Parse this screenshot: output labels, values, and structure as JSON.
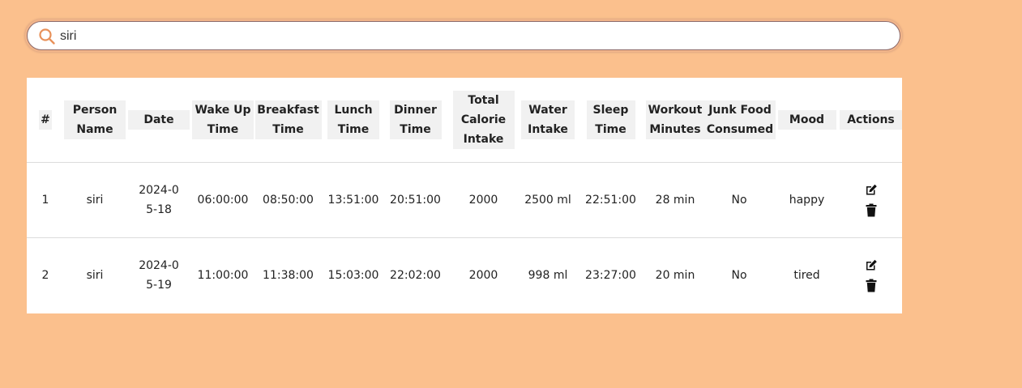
{
  "search": {
    "value": "siri",
    "icon": "search-icon"
  },
  "colors": {
    "page_background": "#fbc08d",
    "search_icon": "#e8915a"
  },
  "table": {
    "headers": [
      "#",
      "Person Name",
      "Date",
      "Wake Up Time",
      "Breakfast Time",
      "Lunch Time",
      "Dinner Time",
      "Total Calorie Intake",
      "Water Intake",
      "Sleep Time",
      "Workout Minutes",
      "Junk Food Consumed",
      "Mood",
      "Actions"
    ],
    "rows": [
      {
        "index": "1",
        "person_name": "siri",
        "date": "2024-05-18",
        "wake_up_time": "06:00:00",
        "breakfast_time": "08:50:00",
        "lunch_time": "13:51:00",
        "dinner_time": "20:51:00",
        "total_calorie_intake": "2000",
        "water_intake": "2500 ml",
        "sleep_time": "22:51:00",
        "workout_minutes": "28 min",
        "junk_food_consumed": "No",
        "mood": "happy"
      },
      {
        "index": "2",
        "person_name": "siri",
        "date": "2024-05-19",
        "wake_up_time": "11:00:00",
        "breakfast_time": "11:38:00",
        "lunch_time": "15:03:00",
        "dinner_time": "22:02:00",
        "total_calorie_intake": "2000",
        "water_intake": "998 ml",
        "sleep_time": "23:27:00",
        "workout_minutes": "20 min",
        "junk_food_consumed": "No",
        "mood": "tired"
      }
    ],
    "action_icons": [
      "edit-icon",
      "trash-icon"
    ]
  }
}
